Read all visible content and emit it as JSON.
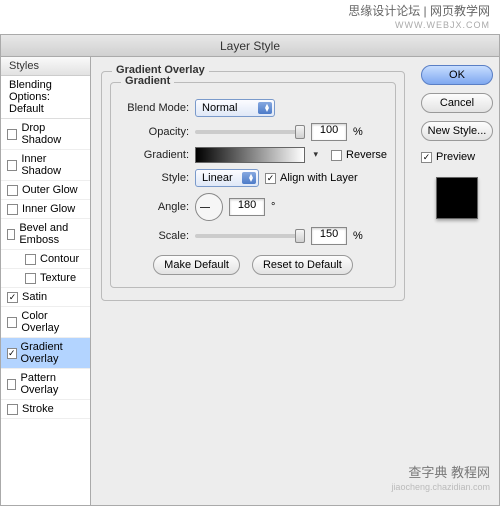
{
  "watermarks": {
    "top_a": "思缘设计论坛 | 网页教学网",
    "top_b": "WWW.WEBJX.COM",
    "bot_a": "查字典 教程网",
    "bot_b": "jiaocheng.chazidian.com"
  },
  "title": "Layer Style",
  "sidebar": {
    "header": "Styles",
    "blending": "Blending Options: Default",
    "items": [
      {
        "label": "Drop Shadow",
        "checked": false
      },
      {
        "label": "Inner Shadow",
        "checked": false
      },
      {
        "label": "Outer Glow",
        "checked": false
      },
      {
        "label": "Inner Glow",
        "checked": false
      },
      {
        "label": "Bevel and Emboss",
        "checked": false
      },
      {
        "label": "Contour",
        "checked": false,
        "indent": true
      },
      {
        "label": "Texture",
        "checked": false,
        "indent": true
      },
      {
        "label": "Satin",
        "checked": true
      },
      {
        "label": "Color Overlay",
        "checked": false
      },
      {
        "label": "Gradient Overlay",
        "checked": true,
        "selected": true
      },
      {
        "label": "Pattern Overlay",
        "checked": false
      },
      {
        "label": "Stroke",
        "checked": false
      }
    ]
  },
  "panel": {
    "title": "Gradient Overlay",
    "subtitle": "Gradient",
    "blend_mode_label": "Blend Mode:",
    "blend_mode_value": "Normal",
    "opacity_label": "Opacity:",
    "opacity_value": "100",
    "pct": "%",
    "gradient_label": "Gradient:",
    "reverse_label": "Reverse",
    "style_label": "Style:",
    "style_value": "Linear",
    "align_label": "Align with Layer",
    "angle_label": "Angle:",
    "angle_value": "180",
    "deg": "°",
    "scale_label": "Scale:",
    "scale_value": "150",
    "make_default": "Make Default",
    "reset_default": "Reset to Default"
  },
  "buttons": {
    "ok": "OK",
    "cancel": "Cancel",
    "new_style": "New Style...",
    "preview": "Preview"
  }
}
